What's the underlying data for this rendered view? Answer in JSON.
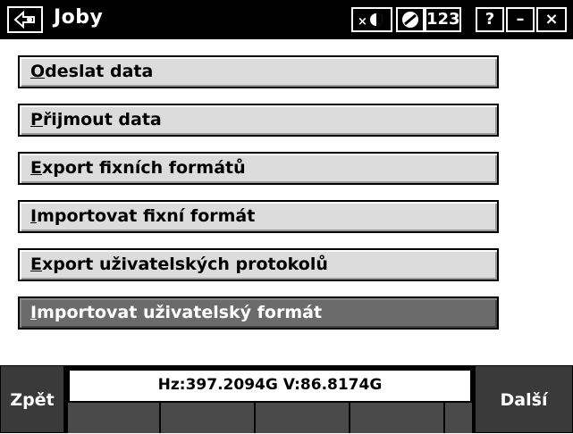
{
  "window": {
    "title": "Joby",
    "indicator_pill_label": "123",
    "help_label": "?",
    "minimize_label": "–",
    "close_label": "×"
  },
  "menu": {
    "items": [
      {
        "mnemonic": "O",
        "rest": "deslat data",
        "selected": false
      },
      {
        "mnemonic": "P",
        "rest": "řijmout data",
        "selected": false
      },
      {
        "mnemonic": "E",
        "rest": "xport fixních formátů",
        "selected": false
      },
      {
        "mnemonic": "I",
        "rest": "mportovat fixní formát",
        "selected": false
      },
      {
        "mnemonic": "E",
        "rest": "xport uživatelských protokolů",
        "selected": false
      },
      {
        "mnemonic": "I",
        "rest": "mportovat uživatelský formát",
        "selected": true
      }
    ]
  },
  "bottom": {
    "back_label": "Zpět",
    "next_label": "Další",
    "status": "Hz:397.2094G  V:86.8174G"
  },
  "colors": {
    "titlebar": "#000000",
    "menu_item": "#dcdcdc",
    "menu_item_selected": "#6b6b6b",
    "softkey": "#3a3a3a"
  }
}
